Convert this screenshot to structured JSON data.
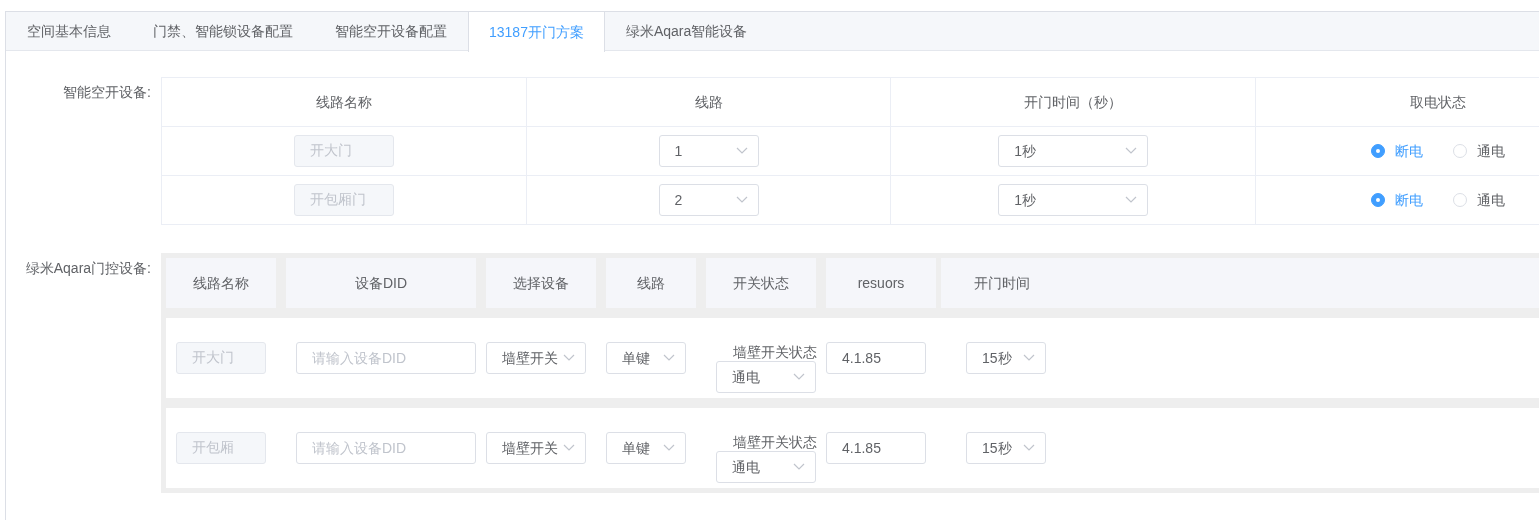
{
  "tabs": [
    {
      "label": "空间基本信息",
      "selected": false
    },
    {
      "label": "门禁、智能锁设备配置",
      "selected": false
    },
    {
      "label": "智能空开设备配置",
      "selected": false
    },
    {
      "label": "13187开门方案",
      "selected": true
    },
    {
      "label": "绿米Aqara智能设备",
      "selected": false
    }
  ],
  "breaker_section": {
    "label": "智能空开设备:",
    "columns": [
      "线路名称",
      "线路",
      "开门时间（秒）",
      "取电状态"
    ],
    "rows": [
      {
        "name": "开大门",
        "line": "1",
        "time": "1秒",
        "options": [
          {
            "label": "断电",
            "selected": true
          },
          {
            "label": "通电",
            "selected": false
          }
        ]
      },
      {
        "name": "开包厢门",
        "line": "2",
        "time": "1秒",
        "options": [
          {
            "label": "断电",
            "selected": true
          },
          {
            "label": "通电",
            "selected": false
          }
        ]
      }
    ]
  },
  "aqara_section": {
    "label": "绿米Aqara门控设备:",
    "columns": [
      "线路名称",
      "设备DID",
      "选择设备",
      "线路",
      "开关状态",
      "resuors",
      "开门时间"
    ],
    "rows": [
      {
        "name": "开大门",
        "did_placeholder": "请输入设备DID",
        "device": "墙壁开关",
        "line": "单键",
        "switch_label": "墙壁开关状态",
        "switch_state": "通电",
        "resuors": "4.1.85",
        "time": "15秒"
      },
      {
        "name": "开包厢",
        "did_placeholder": "请输入设备DID",
        "device": "墙壁开关",
        "line": "单键",
        "switch_label": "墙壁开关状态",
        "switch_state": "通电",
        "resuors": "4.1.85",
        "time": "15秒"
      }
    ]
  }
}
